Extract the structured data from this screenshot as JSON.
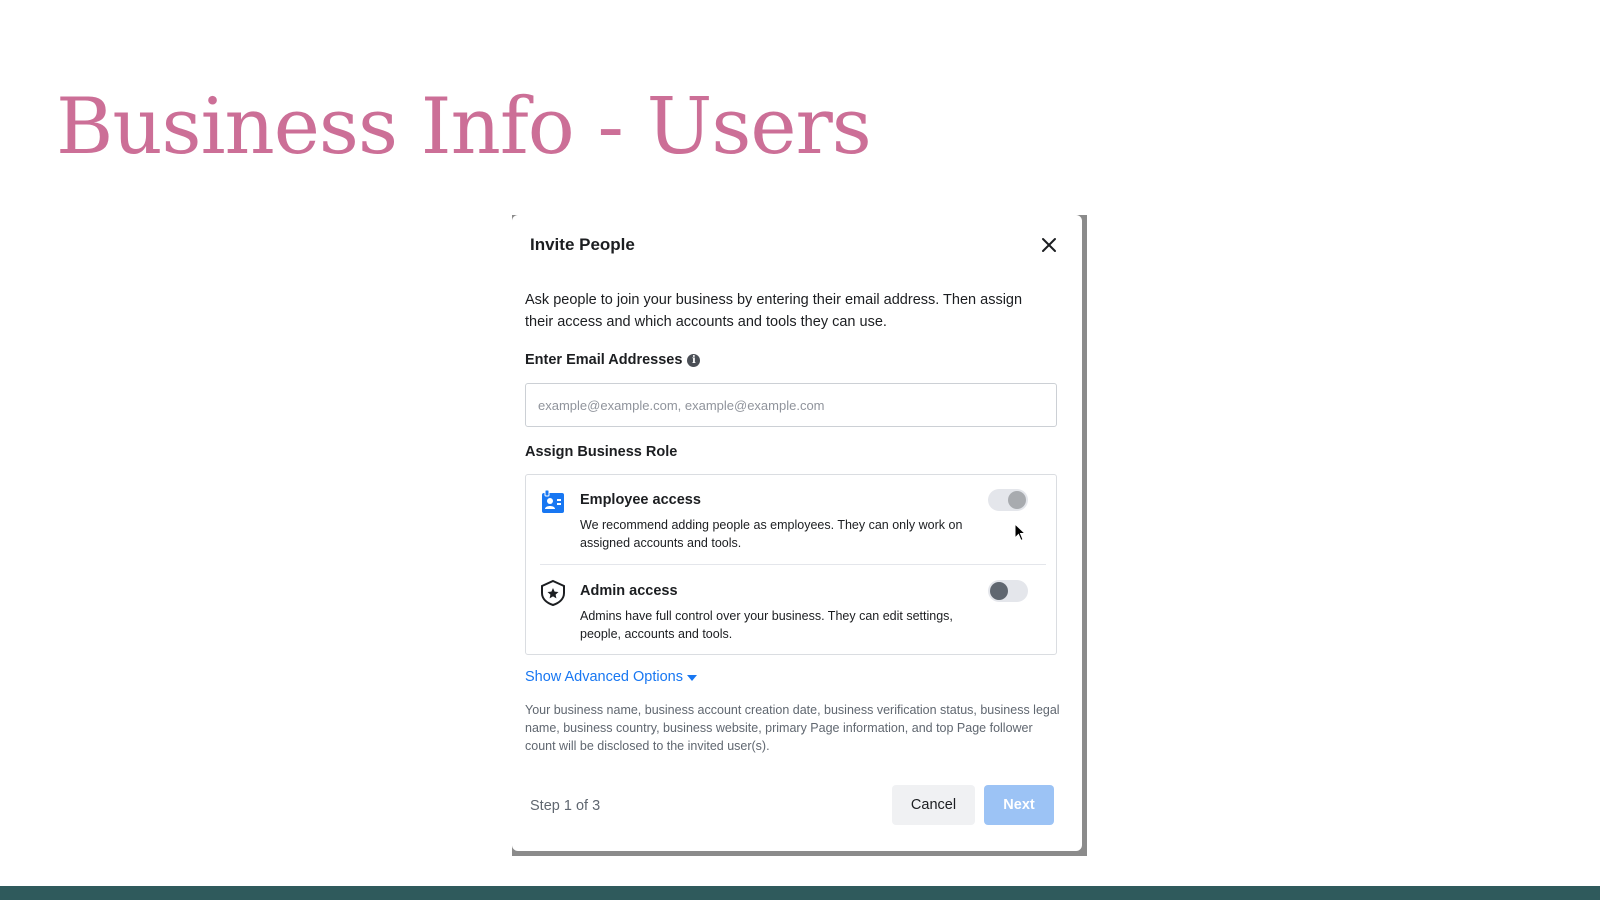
{
  "slide": {
    "title": "Business Info - Users"
  },
  "dialog": {
    "title": "Invite People",
    "intro": "Ask people to join your business by entering their email address. Then assign their access and which accounts and tools they can use.",
    "email_label": "Enter Email Addresses",
    "email_placeholder": "example@example.com, example@example.com",
    "email_value": "",
    "role_label": "Assign Business Role",
    "roles": [
      {
        "name": "Employee access",
        "description": "We recommend adding people as employees. They can only work on assigned accounts and tools.",
        "icon": "employee-badge-icon"
      },
      {
        "name": "Admin access",
        "description": "Admins have full control over your business. They can edit settings, people, accounts and tools.",
        "icon": "admin-shield-icon"
      }
    ],
    "advanced_link": "Show Advanced Options",
    "disclosure": "Your business name, business account creation date, business verification status, business legal name, business country, business website, primary Page information, and top Page follower count will be disclosed to the invited user(s).",
    "step": "Step 1 of 3",
    "cancel_label": "Cancel",
    "next_label": "Next"
  },
  "colors": {
    "title": "#cc6f97",
    "bottom_bar": "#2f5a5c",
    "link": "#1877f2",
    "next_disabled": "#9cc3f5"
  }
}
